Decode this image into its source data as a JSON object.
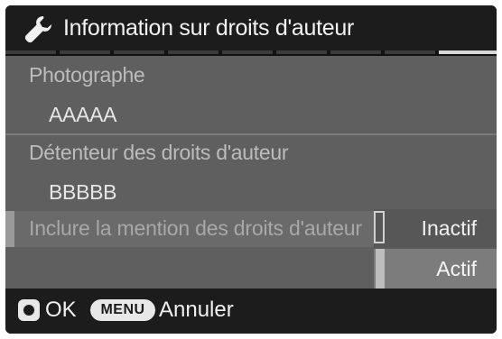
{
  "header": {
    "title": "Information sur droits d'auteur",
    "icon": "wrench-icon"
  },
  "fields": {
    "photographer_label": "Photographe",
    "photographer_value": "AAAAA",
    "holder_label": "Détenteur des droits d'auteur",
    "holder_value": "BBBBB",
    "include_label": "Inclure la mention des droits d'auteur"
  },
  "dropdown": {
    "options": [
      "Inactif",
      "Actif"
    ],
    "selected": "Actif"
  },
  "footer": {
    "ok_label": "OK",
    "menu_label": "MENU",
    "cancel_label": "Annuler"
  }
}
